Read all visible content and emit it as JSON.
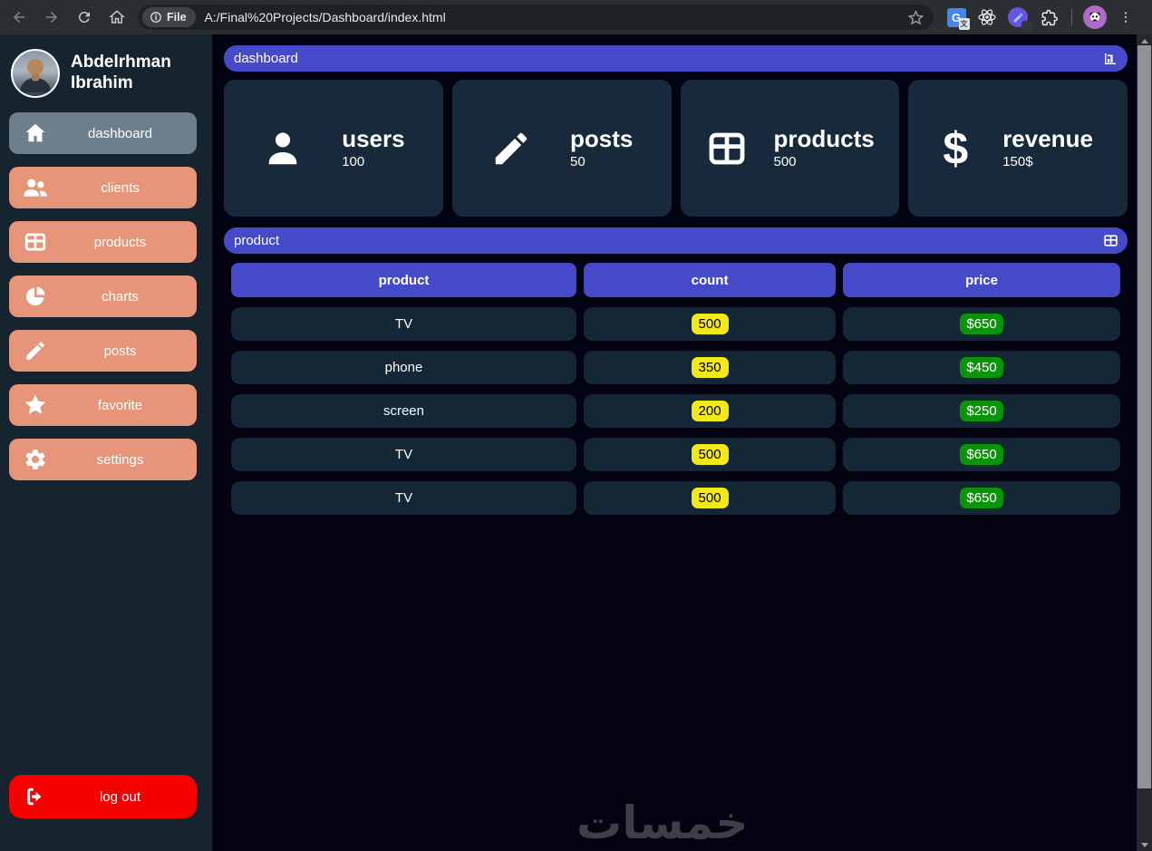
{
  "browser": {
    "file_chip_label": "File",
    "url": "A:/Final%20Projects/Dashboard/index.html"
  },
  "sidebar": {
    "profile_name_line1": "Abdelrhman",
    "profile_name_line2": "Ibrahim",
    "items": [
      {
        "label": "dashboard",
        "icon": "home-icon",
        "active": true
      },
      {
        "label": "clients",
        "icon": "users-icon",
        "active": false
      },
      {
        "label": "products",
        "icon": "table-icon",
        "active": false
      },
      {
        "label": "charts",
        "icon": "pie-chart-icon",
        "active": false
      },
      {
        "label": "posts",
        "icon": "pencil-icon",
        "active": false
      },
      {
        "label": "favorite",
        "icon": "star-icon",
        "active": false
      },
      {
        "label": "settings",
        "icon": "gear-icon",
        "active": false
      }
    ],
    "logout_label": "log out"
  },
  "main": {
    "dashboard_section_title": "dashboard",
    "cards": [
      {
        "title": "users",
        "value": "100",
        "icon": "user-icon"
      },
      {
        "title": "posts",
        "value": "50",
        "icon": "pencil-icon"
      },
      {
        "title": "products",
        "value": "500",
        "icon": "table-icon"
      },
      {
        "title": "revenue",
        "value": "150$",
        "icon": "dollar-icon"
      }
    ],
    "product_section_title": "product",
    "table": {
      "headers": [
        "product",
        "count",
        "price"
      ],
      "rows": [
        {
          "product": "TV",
          "count": "500",
          "price": "$650"
        },
        {
          "product": "phone",
          "count": "350",
          "price": "$450"
        },
        {
          "product": "screen",
          "count": "200",
          "price": "$250"
        },
        {
          "product": "TV",
          "count": "500",
          "price": "$650"
        },
        {
          "product": "TV",
          "count": "500",
          "price": "$650"
        }
      ]
    },
    "watermark": "خمسات"
  },
  "colors": {
    "accent_blue": "#474ac8",
    "sidebar_item_salmon": "#e7957a",
    "sidebar_item_active_gray": "#6d7f8c",
    "logout_red": "#f60000",
    "count_badge_yellow": "#f3ea15",
    "price_badge_green": "#0a9408",
    "card_bg": "#17293a",
    "main_bg": "#030312",
    "sidebar_bg": "#15242f"
  }
}
